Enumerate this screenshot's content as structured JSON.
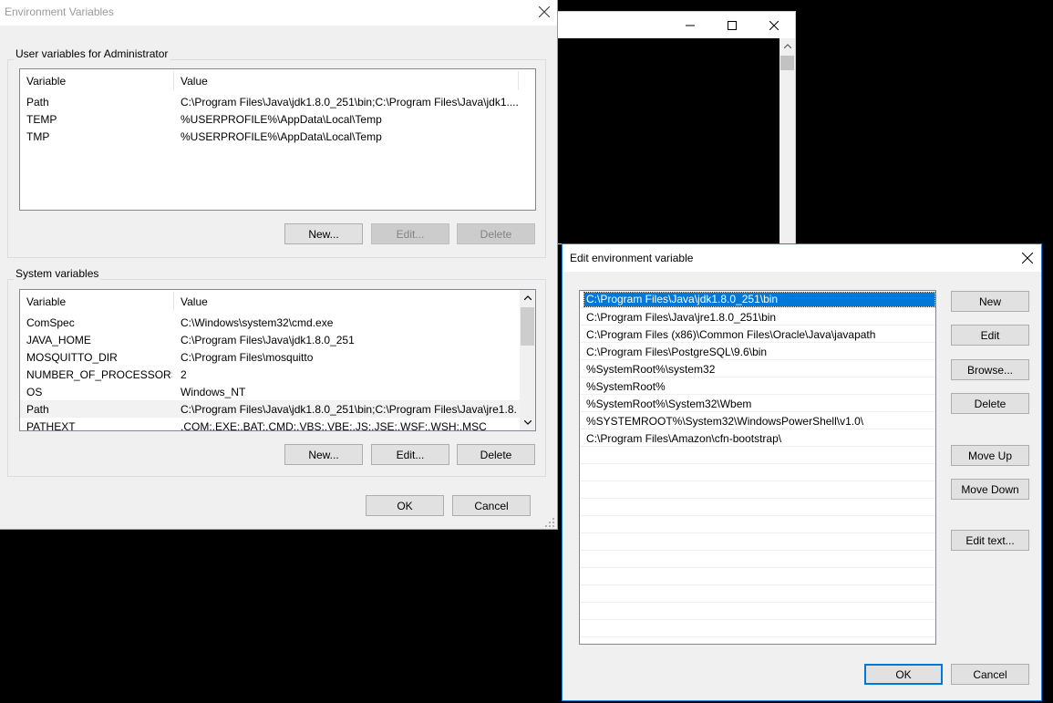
{
  "env_dialog": {
    "title": "Environment Variables",
    "user_group_label": "User variables for Administrator",
    "system_group_label": "System variables",
    "columns": {
      "variable": "Variable",
      "value": "Value"
    },
    "user_rows": [
      {
        "variable": "Path",
        "value": "C:\\Program Files\\Java\\jdk1.8.0_251\\bin;C:\\Program Files\\Java\\jdk1...."
      },
      {
        "variable": "TEMP",
        "value": "%USERPROFILE%\\AppData\\Local\\Temp"
      },
      {
        "variable": "TMP",
        "value": "%USERPROFILE%\\AppData\\Local\\Temp"
      }
    ],
    "system_rows": [
      {
        "variable": "ComSpec",
        "value": "C:\\Windows\\system32\\cmd.exe"
      },
      {
        "variable": "JAVA_HOME",
        "value": "C:\\Program Files\\Java\\jdk1.8.0_251"
      },
      {
        "variable": "MOSQUITTO_DIR",
        "value": "C:\\Program Files\\mosquitto"
      },
      {
        "variable": "NUMBER_OF_PROCESSORS",
        "value": "2"
      },
      {
        "variable": "OS",
        "value": "Windows_NT"
      },
      {
        "variable": "Path",
        "value": "C:\\Program Files\\Java\\jdk1.8.0_251\\bin;C:\\Program Files\\Java\\jre1.8..."
      },
      {
        "variable": "PATHEXT",
        "value": ".COM;.EXE;.BAT;.CMD;.VBS;.VBE;.JS;.JSE;.WSF;.WSH;.MSC"
      }
    ],
    "user_buttons": {
      "new": "New...",
      "edit": "Edit...",
      "delete": "Delete"
    },
    "system_buttons": {
      "new": "New...",
      "edit": "Edit...",
      "delete": "Delete"
    },
    "ok": "OK",
    "cancel": "Cancel"
  },
  "edit_dialog": {
    "title": "Edit environment variable",
    "entries": [
      "C:\\Program Files\\Java\\jdk1.8.0_251\\bin",
      "C:\\Program Files\\Java\\jre1.8.0_251\\bin",
      "C:\\Program Files (x86)\\Common Files\\Oracle\\Java\\javapath",
      "C:\\Program Files\\PostgreSQL\\9.6\\bin",
      "%SystemRoot%\\system32",
      "%SystemRoot%",
      "%SystemRoot%\\System32\\Wbem",
      "%SYSTEMROOT%\\System32\\WindowsPowerShell\\v1.0\\",
      "C:\\Program Files\\Amazon\\cfn-bootstrap\\"
    ],
    "buttons": {
      "new": "New",
      "edit": "Edit",
      "browse": "Browse...",
      "delete": "Delete",
      "move_up": "Move Up",
      "move_down": "Move Down",
      "edit_text": "Edit text..."
    },
    "ok": "OK",
    "cancel": "Cancel"
  },
  "icons": {
    "close": "close-icon",
    "minimize": "minimize-icon",
    "maximize": "maximize-icon",
    "scroll_up": "chevron-up-icon",
    "scroll_down": "chevron-down-icon",
    "size_grip": "resize-grip-icon"
  },
  "colors": {
    "selection": "#0078d7",
    "dialog_bg": "#f0f0f0",
    "active_border": "#1883d7"
  }
}
